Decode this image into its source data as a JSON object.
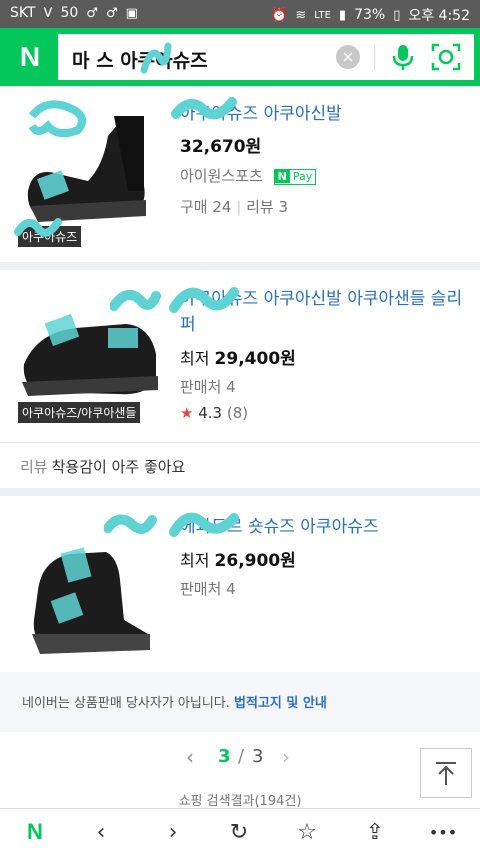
{
  "status_bar": {
    "carrier": "SKT",
    "signal_text": "50",
    "battery": "73%",
    "time": "오후 4:52",
    "lte": "LTE"
  },
  "search": {
    "logo": "N",
    "query": "마  스 아쿠아슈즈"
  },
  "products": [
    {
      "title": "   아쿠아슈즈 아쿠아신발",
      "price_prefix": "",
      "price": "32,670원",
      "seller": "아이원스포츠",
      "npay": "Pay",
      "purchases_label": "구매 24",
      "reviews_label": "리뷰 3",
      "thumb_label": "   아쿠아슈즈"
    },
    {
      "title": "   아쿠아슈즈 아쿠아신발 아쿠아샌들 슬리퍼",
      "price_prefix": "최저",
      "price": "29,400원",
      "sellers": "판매처 4",
      "rating": "4.3",
      "rating_count": "(8)",
      "thumb_label": "아쿠아슈즈/아쿠아샌들",
      "review_key": "리뷰",
      "review_text": "착용감이 아주 좋아요"
    },
    {
      "title": "   에콰도르 숏슈즈 아쿠아슈즈",
      "price_prefix": "최저",
      "price": "26,900원",
      "sellers": "판매처 4"
    }
  ],
  "notice": {
    "text": "네이버는 상품판매 당사자가 아닙니다.",
    "link": "법적고지 및 안내"
  },
  "pagination": {
    "current": "3",
    "separator": "/",
    "total": "3"
  },
  "bottom_peek": "쇼핑 검색결과(194건)",
  "colors": {
    "brand_green": "#03c75a",
    "link_blue": "#2a6fc1",
    "scribble": "#5fd3d3"
  }
}
